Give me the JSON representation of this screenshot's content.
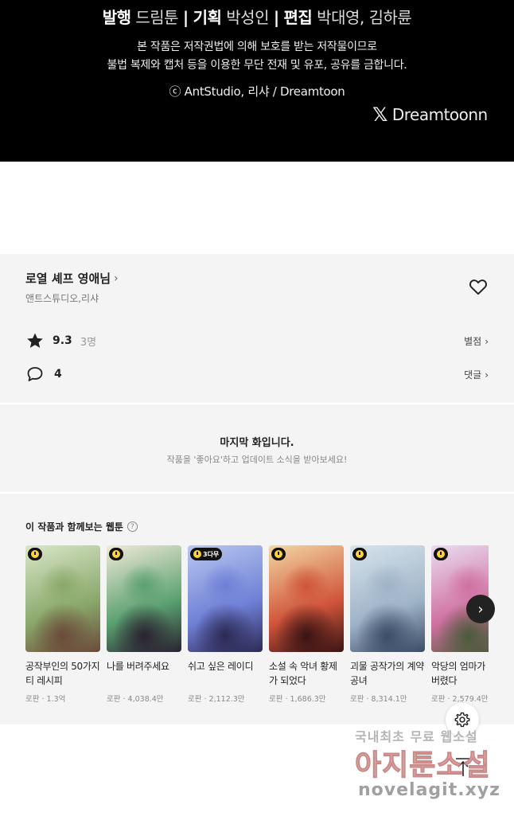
{
  "credits": {
    "publisher_label": "발행",
    "publisher": "드림툰",
    "planning_label": "기획",
    "planner": "박성인",
    "editor_label": "편집",
    "editors": "박대영, 김하륜",
    "sep": "|",
    "notice_line1": "본 작품은 저작권법에 의해 보호를 받는 저작물이므로",
    "notice_line2": "불법 복제와 캡처 등을 이용한 무단 전재 및 유포, 공유를 금합니다.",
    "copyright": "ⓒ AntStudio, 리샤 / Dreamtoon",
    "x_handle": "Dreamtoonn"
  },
  "work": {
    "title": "로열 셰프 영애님",
    "author": "앤트스튜디오,리샤",
    "rating": "9.3",
    "rating_count": "3명",
    "rating_link": "별점",
    "comments": "4",
    "comments_link": "댓글"
  },
  "last_episode": {
    "title": "마지막 화입니다.",
    "subtitle": "작품을 '좋아요'하고 업데이트 소식을 받아보세요!"
  },
  "recommend": {
    "title": "이 작품과 함께보는 웹툰",
    "help": "?",
    "items": [
      {
        "title": "공작부인의 50가지 티 레시피",
        "meta": "로판 · 1.3억",
        "badge": "",
        "colors": [
          "#d9e6c8",
          "#8aa86a",
          "#6b4a3a"
        ]
      },
      {
        "title": "나를 버려주세요",
        "meta": "로판 · 4,038.4만",
        "badge": "",
        "colors": [
          "#f1ead6",
          "#5aa070",
          "#2a2230"
        ]
      },
      {
        "title": "쉬고 싶은 레이디",
        "meta": "로판 · 2,112.3만",
        "badge": "3다무",
        "colors": [
          "#b7c8f0",
          "#6f7fd6",
          "#2c2a54"
        ]
      },
      {
        "title": "소설 속 악녀 황제가 되었다",
        "meta": "로판 · 1,686.3만",
        "badge": "",
        "colors": [
          "#f3d7a3",
          "#d0543a",
          "#3a1414"
        ]
      },
      {
        "title": "괴물 공작가의 계약 공녀",
        "meta": "로판 · 8,314.1만",
        "badge": "",
        "colors": [
          "#d6e4ec",
          "#9fb3c8",
          "#3b4c66"
        ]
      },
      {
        "title": "악당의 엄마가 되어버렸다",
        "meta": "로판 · 2,579.4만",
        "badge": "",
        "colors": [
          "#eadcf0",
          "#d070a0",
          "#4a5a3a"
        ]
      }
    ],
    "next": "›"
  },
  "watermark": {
    "line1": "국내최초 무료 웹소설",
    "line2": "아지툰소설",
    "line3": "novelagit.xyz"
  }
}
